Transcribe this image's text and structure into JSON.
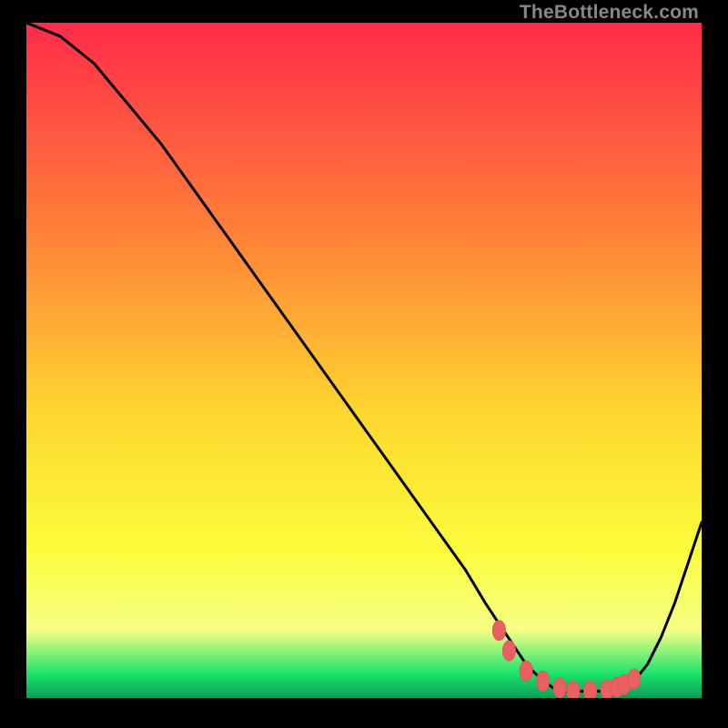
{
  "watermark": "TheBottleneck.com",
  "colors": {
    "gradient_top": "#ff2b4a",
    "gradient_mid_upper": "#ff8438",
    "gradient_mid": "#fdd730",
    "gradient_mid_lower": "#fcfc3b",
    "gradient_low": "#f5ff85",
    "gradient_green": "#19e36a",
    "gradient_bottom": "#0c9d57",
    "curve": "#000000",
    "marker_fill": "#e86061",
    "marker_stroke": "#e45556"
  },
  "chart_data": {
    "type": "line",
    "title": "",
    "xlabel": "",
    "ylabel": "",
    "xlim": [
      0,
      100
    ],
    "ylim": [
      0,
      100
    ],
    "series": [
      {
        "name": "bottleneck-curve",
        "x": [
          0,
          5,
          10,
          15,
          20,
          25,
          30,
          35,
          40,
          45,
          50,
          55,
          60,
          65,
          68,
          70,
          72,
          74,
          76,
          78,
          80,
          82,
          84,
          86,
          88,
          90,
          92,
          94,
          96,
          98,
          100
        ],
        "y": [
          100,
          98,
          94,
          88,
          82,
          75,
          68,
          61,
          54,
          47,
          40,
          33,
          26,
          19,
          14,
          11,
          8,
          5,
          3,
          1.5,
          1,
          1,
          1,
          1,
          1.5,
          2.5,
          5,
          9,
          14,
          20,
          26
        ]
      }
    ],
    "markers": {
      "name": "highlight-points",
      "x": [
        70,
        71.5,
        74,
        76.5,
        79,
        81,
        83.5,
        86,
        87.5,
        88.5,
        90
      ],
      "y": [
        10,
        7,
        4,
        2.5,
        1.5,
        1,
        1,
        1.2,
        1.6,
        2.0,
        2.8
      ]
    }
  }
}
